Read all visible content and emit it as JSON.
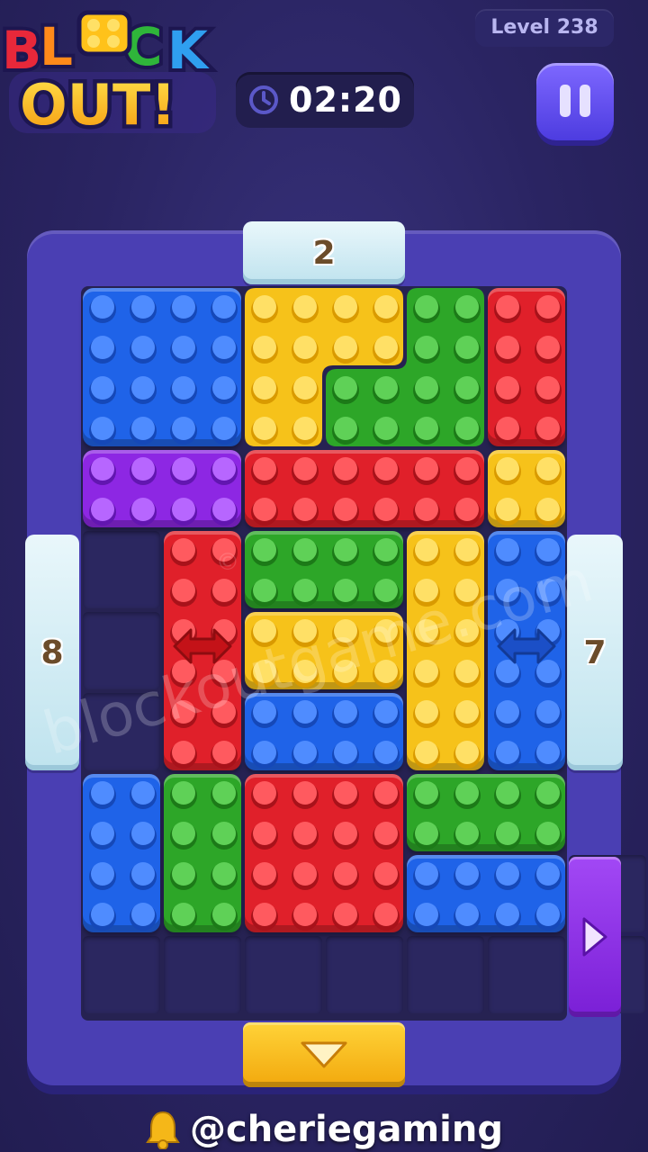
{
  "header": {
    "logo_line1": "BLOCK",
    "logo_line2": "OUT!",
    "level_label": "Level 238",
    "timer": "02:20"
  },
  "gates": {
    "top_count": "2",
    "left_count": "8",
    "right_count": "7"
  },
  "colors": {
    "blue": "#1f63e8",
    "yellow": "#f6c21a",
    "green": "#2da628",
    "red": "#e0202a",
    "purple": "#8d27e3",
    "frame": "#4a3fb3",
    "gate_ice": "#d6eef5"
  },
  "watermark": "blockoutgame.com",
  "watermark_small": "©",
  "footer": {
    "handle": "@cheriegaming"
  }
}
